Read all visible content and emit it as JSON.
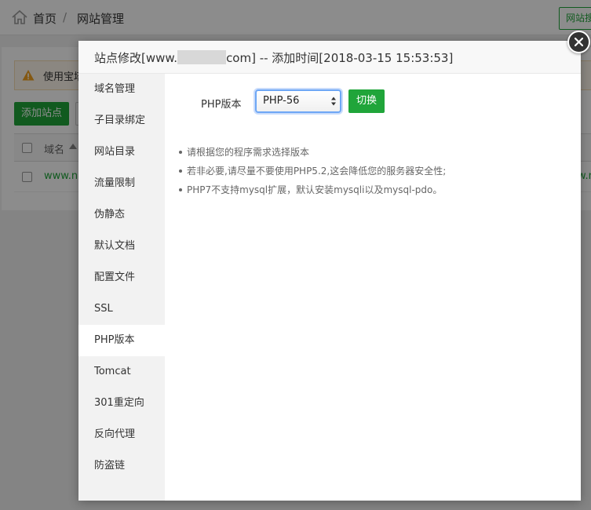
{
  "breadcrumb": {
    "home": "首页",
    "separator": "/",
    "current": "网站管理"
  },
  "topbar": {
    "right_button_label": "网站搜"
  },
  "background": {
    "warning_text": "使用宝塔",
    "add_site_label": "添加站点",
    "table_header_domain": "域名",
    "row_site": "www.na",
    "row_right_text": "w.n"
  },
  "modal": {
    "title_prefix": "站点修改[www.",
    "title_suffix": "com] -- 添加时间[2018-03-15 15:53:53]",
    "sidebar": [
      {
        "label": "域名管理"
      },
      {
        "label": "子目录绑定"
      },
      {
        "label": "网站目录"
      },
      {
        "label": "流量限制"
      },
      {
        "label": "伪静态"
      },
      {
        "label": "默认文档"
      },
      {
        "label": "配置文件"
      },
      {
        "label": "SSL"
      },
      {
        "label": "PHP版本",
        "active": true
      },
      {
        "label": "Tomcat"
      },
      {
        "label": "301重定向"
      },
      {
        "label": "反向代理"
      },
      {
        "label": "防盗链"
      }
    ],
    "php": {
      "label": "PHP版本",
      "selected": "PHP-56",
      "switch_label": "切换"
    },
    "tips": [
      "请根据您的程序需求选择版本",
      "若非必要,请尽量不要使用PHP5.2,这会降低您的服务器安全性;",
      "PHP7不支持mysql扩展，默认安装mysqli以及mysql-pdo。"
    ]
  },
  "colors": {
    "accent": "#20a53a",
    "focus": "#6ea7f5"
  }
}
